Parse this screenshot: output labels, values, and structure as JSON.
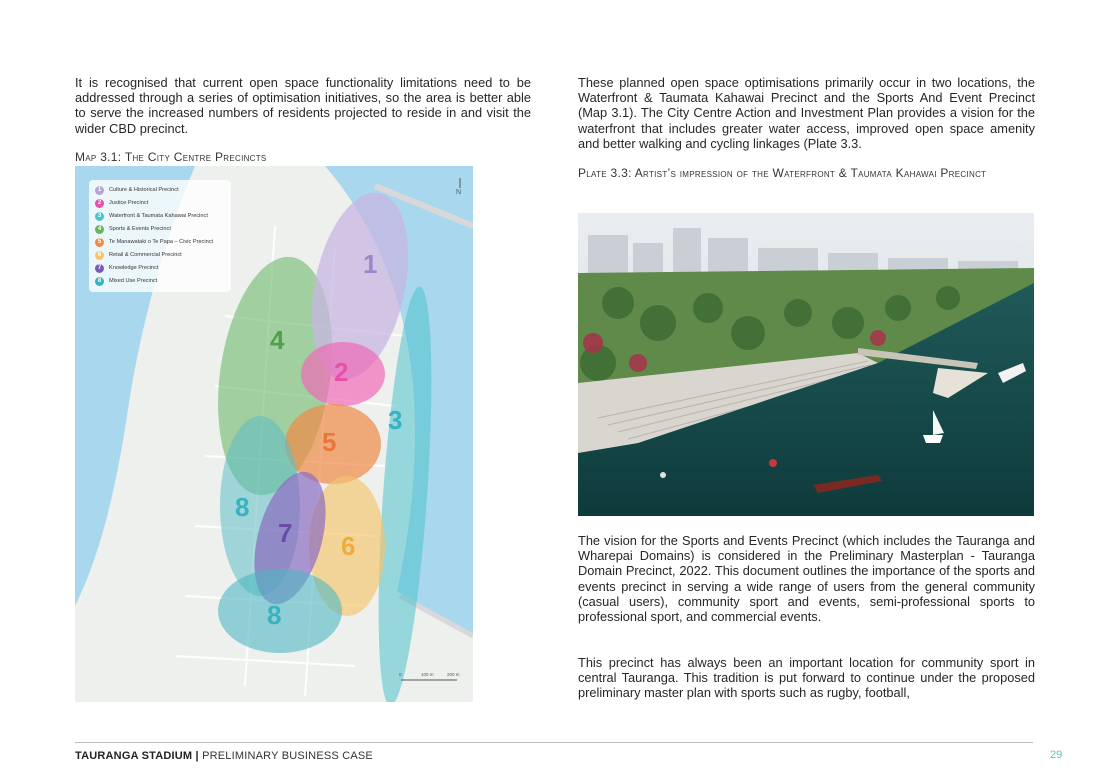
{
  "left_column": {
    "intro": "It is recognised that current open space functionality limitations need to be addressed through a series of optimisation initiatives, so the area is better able to serve the increased numbers of residents projected to reside in and visit the wider CBD precinct.",
    "map_caption": "Map 3.1: The City Centre Precincts"
  },
  "map": {
    "legend": [
      {
        "num": "1",
        "label": "Culture & Historical Precinct",
        "color": "#b7a3d6"
      },
      {
        "num": "2",
        "label": "Justice Precinct",
        "color": "#e94fa9"
      },
      {
        "num": "3",
        "label": "Waterfront & Taumata Kahawai Precinct",
        "color": "#4fc3cc"
      },
      {
        "num": "4",
        "label": "Sports & Events Precinct",
        "color": "#63b55f"
      },
      {
        "num": "5",
        "label": "Te Manawataki o Te Papa – Civic Precinct",
        "color": "#ef8a46"
      },
      {
        "num": "6",
        "label": "Retail & Commercial Precinct",
        "color": "#f5c46a"
      },
      {
        "num": "7",
        "label": "Knowledge Precinct",
        "color": "#7a5cb0"
      },
      {
        "num": "8",
        "label": "Mixed Use Precinct",
        "color": "#35b3c0"
      }
    ],
    "precinct_numbers": [
      "1",
      "2",
      "3",
      "4",
      "5",
      "6",
      "7",
      "8",
      "8",
      "8"
    ],
    "north": "N",
    "scale_labels": [
      "0",
      "100 m",
      "200 m"
    ],
    "colors": {
      "water": "#a9d8ee",
      "land": "#eef0ee"
    }
  },
  "right_column": {
    "para1": "These planned open space optimisations primarily occur in two locations, the Waterfront & Taumata Kahawai Precinct and the Sports And Event Precinct (Map 3.1). The City Centre Action and Investment Plan provides a vision for the waterfront that includes greater water access, improved open space amenity and better walking and cycling linkages (Plate 3.3.",
    "plate_caption": "Plate 3.3: Artist’s impression of the Waterfront & Taumata Kahawai Precinct",
    "para2": "The vision for the Sports and Events Precinct (which includes the Tauranga and Wharepai Domains) is considered in the Preliminary Masterplan - Tauranga Domain Precinct, 2022. This document outlines the importance of the sports and events precinct in serving a wide range of users from the general community (casual users), community sport and events, semi-professional sports to professional sport, and commercial events.",
    "para3": "This precinct has always been an important location for community sport in central Tauranga. This tradition is put forward to continue under the proposed preliminary master plan with sports such as rugby, football,"
  },
  "footer": {
    "title_bold": "TAURANGA STADIUM",
    "separator": "|",
    "title_rest": "PRELIMINARY BUSINESS CASE",
    "page_number": "29",
    "accent_color": "#5fbfbc"
  }
}
